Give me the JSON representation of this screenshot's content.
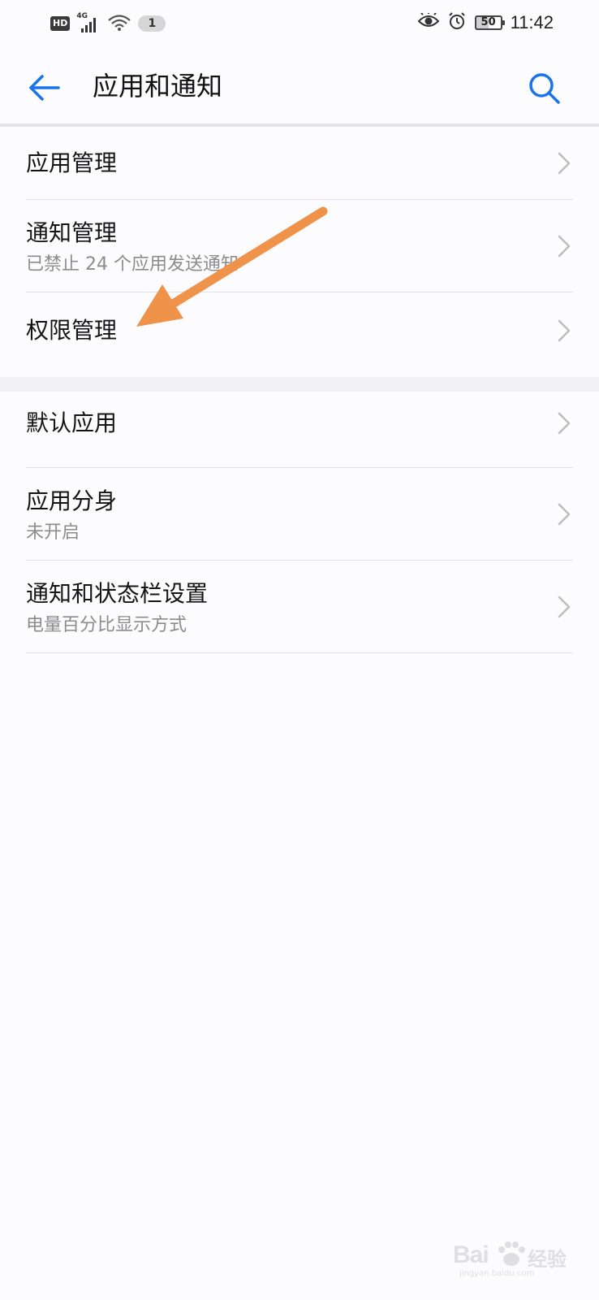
{
  "status_bar": {
    "hd_label": "HD",
    "network_label": "4G",
    "notification_count": "1",
    "battery_level": "50",
    "time": "11:42",
    "icons": [
      "hd-icon",
      "signal-icon",
      "wifi-icon",
      "eye-comfort-icon",
      "alarm-icon",
      "battery-icon"
    ]
  },
  "header": {
    "title": "应用和通知",
    "back_icon": "arrow-left-icon",
    "search_icon": "search-icon",
    "accent_color": "#1a73e8"
  },
  "groups": [
    {
      "items": [
        {
          "title": "应用管理",
          "subtitle": ""
        },
        {
          "title": "通知管理",
          "subtitle": "已禁止 24 个应用发送通知"
        },
        {
          "title": "权限管理",
          "subtitle": ""
        }
      ]
    },
    {
      "items": [
        {
          "title": "默认应用",
          "subtitle": ""
        },
        {
          "title": "应用分身",
          "subtitle": "未开启"
        },
        {
          "title": "通知和状态栏设置",
          "subtitle": "电量百分比显示方式"
        }
      ]
    }
  ],
  "annotation": {
    "arrow_color": "#f0934a",
    "points_to": "权限管理"
  },
  "watermark": {
    "brand": "Bai",
    "suffix": "经验",
    "url": "jingyan.baidu.com"
  }
}
